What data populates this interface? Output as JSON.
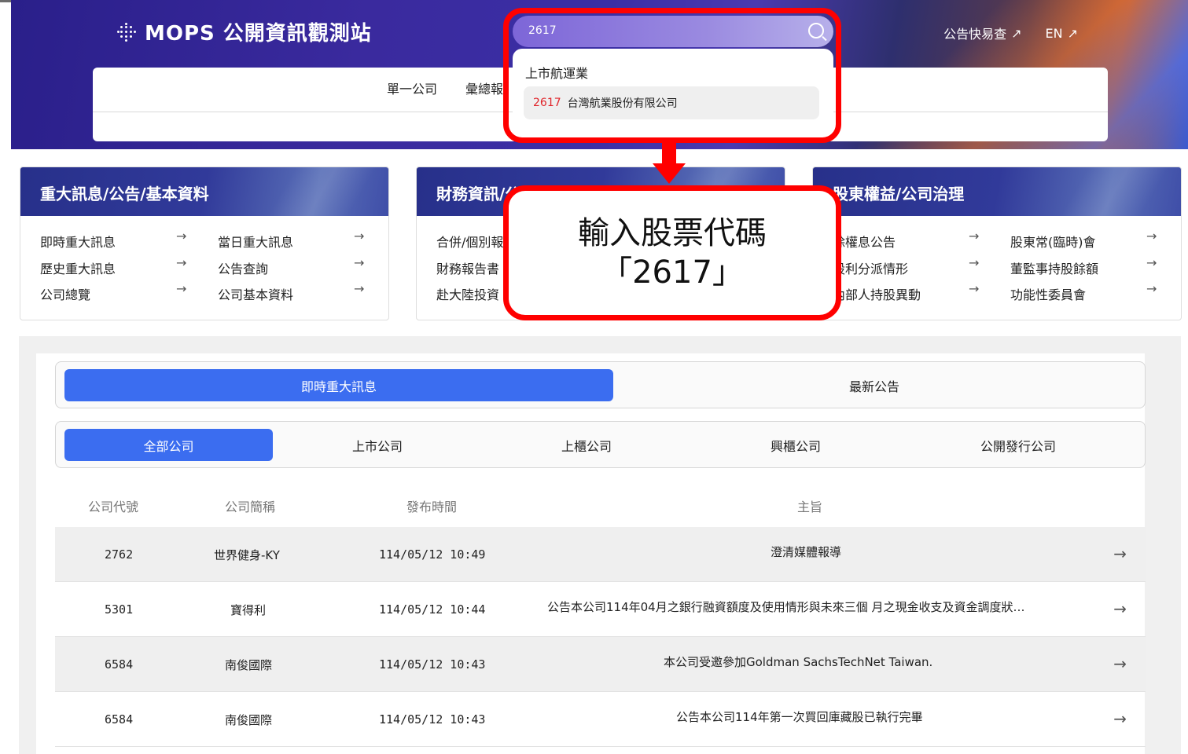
{
  "header": {
    "logo_text": "MOPS 公開資訊觀測站",
    "links": [
      {
        "label": "公告快易查",
        "arrow": "↗"
      },
      {
        "label": "EN",
        "arrow": "↗"
      }
    ],
    "nav": [
      "單一公司",
      "彙總報"
    ]
  },
  "search": {
    "value": "2617",
    "group_label": "上市航運業",
    "result_code": "2617",
    "result_name": "台灣航業股份有限公司"
  },
  "callout": {
    "line1": "輸入股票代碼",
    "line2": "「2617」"
  },
  "categories": [
    {
      "title": "重大訊息/公告/基本資料",
      "links": [
        "即時重大訊息",
        "當日重大訊息",
        "歷史重大訊息",
        "公告查詢",
        "公司總覽",
        "公司基本資料"
      ]
    },
    {
      "title": "財務資訊/公",
      "links": [
        "合併/個別報",
        "財務報告書",
        "赴大陸投資"
      ]
    },
    {
      "title": "股東權益/公司治理",
      "links": [
        "除權息公告",
        "股東常(臨時)會",
        "股利分派情形",
        "董監事持股餘額",
        "內部人持股異動",
        "功能性委員會"
      ]
    }
  ],
  "tabs": [
    "即時重大訊息",
    "最新公告"
  ],
  "filters": [
    "全部公司",
    "上市公司",
    "上櫃公司",
    "興櫃公司",
    "公開發行公司"
  ],
  "table": {
    "headers": [
      "公司代號",
      "公司簡稱",
      "發布時間",
      "主旨"
    ],
    "rows": [
      {
        "code": "2762",
        "name": "世界健身-KY",
        "time": "114/05/12 10:49",
        "subject": "澄清媒體報導"
      },
      {
        "code": "5301",
        "name": "寶得利",
        "time": "114/05/12 10:44",
        "subject": "公告本公司114年04月之銀行融資額度及使用情形與未來三個 月之現金收支及資金調度狀…"
      },
      {
        "code": "6584",
        "name": "南俊國際",
        "time": "114/05/12 10:43",
        "subject": "本公司受邀參加Goldman SachsTechNet Taiwan."
      },
      {
        "code": "6584",
        "name": "南俊國際",
        "time": "114/05/12 10:43",
        "subject": "公告本公司114年第一次買回庫藏股已執行完畢"
      }
    ]
  },
  "arrow_glyph": "→",
  "colors": {
    "accent": "#3b6df0",
    "highlight": "#ff0000",
    "code_red": "#e0252b"
  }
}
